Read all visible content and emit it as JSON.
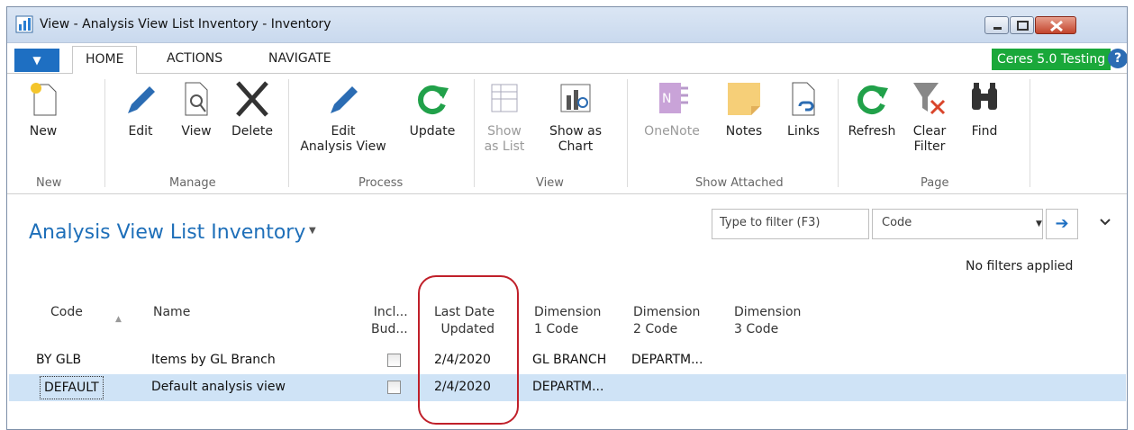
{
  "window": {
    "title": "View - Analysis View List Inventory - Inventory"
  },
  "tabs": {
    "menu_icon": "▼",
    "home": "HOME",
    "actions": "ACTIONS",
    "navigate": "NAVIGATE"
  },
  "badge": {
    "ceres": "Ceres 5.0 Testing",
    "help": "?"
  },
  "ribbon": {
    "new": "New",
    "edit": "Edit",
    "view": "View",
    "delete": "Delete",
    "edit_analysis": "Edit\nAnalysis View",
    "update": "Update",
    "show_list": "Show\nas List",
    "show_chart": "Show as\nChart",
    "onenote": "OneNote",
    "notes": "Notes",
    "links": "Links",
    "refresh": "Refresh",
    "clear_filter": "Clear\nFilter",
    "find": "Find",
    "groups": {
      "new": "New",
      "manage": "Manage",
      "process": "Process",
      "view": "View",
      "show_attached": "Show Attached",
      "page": "Page"
    }
  },
  "page": {
    "title": "Analysis View List Inventory",
    "title_caret": "▼"
  },
  "filter": {
    "placeholder": "Type to filter (F3)",
    "field": "Code",
    "field_caret": "▼",
    "go": "➔",
    "collapse": "✓",
    "status": "No filters applied"
  },
  "grid": {
    "headers": {
      "code": "Code",
      "sort": "▲",
      "name": "Name",
      "incl": "Incl...\nBud...",
      "last_date": "Last Date\nUpdated",
      "dim1": "Dimension\n1 Code",
      "dim2": "Dimension\n2 Code",
      "dim3": "Dimension\n3 Code"
    },
    "rows": [
      {
        "code": "BY GLB",
        "name": "Items by GL Branch",
        "last_date": "2/4/2020",
        "dim1": "GL BRANCH",
        "dim2": "DEPARTM..."
      },
      {
        "code": "DEFAULT",
        "name": "Default analysis view",
        "last_date": "2/4/2020",
        "dim1": "DEPARTM...",
        "dim2": ""
      }
    ]
  },
  "colors": {
    "accent": "#1e6fc2",
    "highlight_ring": "#c0202a",
    "selected_row": "#cfe3f6",
    "badge_green": "#1aa83a"
  }
}
